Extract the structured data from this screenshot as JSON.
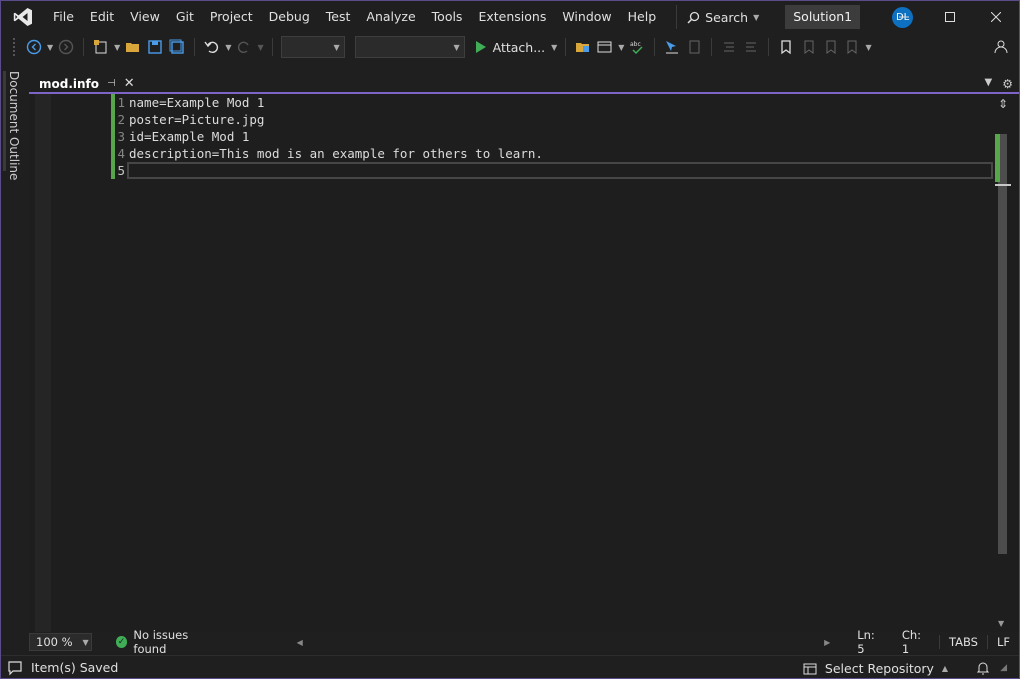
{
  "menu": {
    "items": [
      "File",
      "Edit",
      "View",
      "Git",
      "Project",
      "Debug",
      "Test",
      "Analyze",
      "Tools",
      "Extensions",
      "Window",
      "Help"
    ],
    "search_label": "Search",
    "solution_name": "Solution1",
    "user_initials": "DL"
  },
  "toolbar": {
    "attach_label": "Attach..."
  },
  "side": {
    "document_outline_label": "Document Outline"
  },
  "tabs": {
    "active_tab": "mod.info"
  },
  "editor": {
    "line_numbers": [
      "1",
      "2",
      "3",
      "4",
      "5"
    ],
    "lines": [
      "name=Example Mod 1",
      "poster=Picture.jpg",
      "id=Example Mod 1",
      "description=This mod is an example for others to learn.",
      ""
    ]
  },
  "editor_status": {
    "zoom": "100 %",
    "health": "No issues found",
    "line": "Ln: 5",
    "char": "Ch: 1",
    "indent": "TABS",
    "eol": "LF"
  },
  "statusbar": {
    "message": "Item(s) Saved",
    "repo_label": "Select Repository"
  },
  "colors": {
    "accent": "#7e64c7",
    "change_marker": "#57a64a",
    "avatar": "#0e70c0"
  }
}
